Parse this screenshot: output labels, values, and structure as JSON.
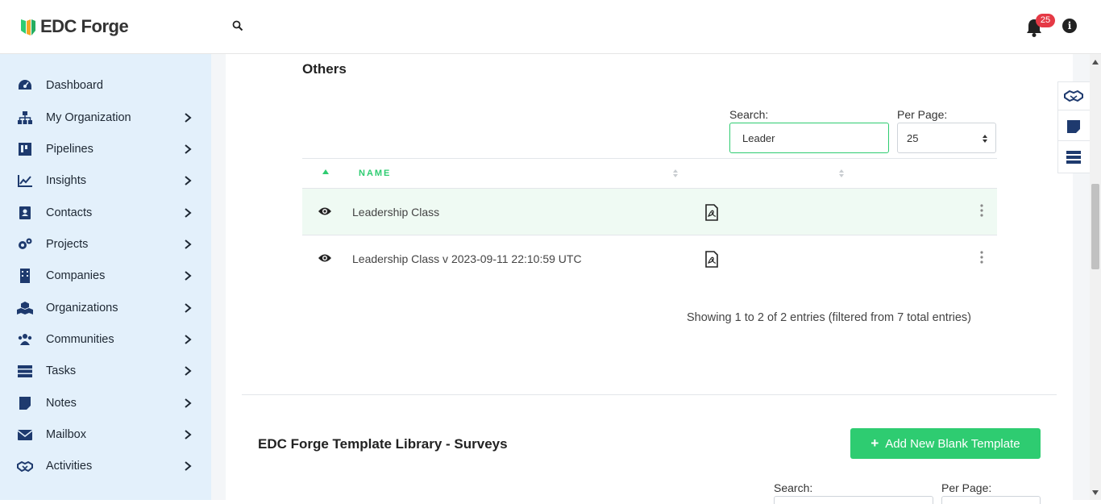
{
  "app": {
    "logo_text": "EDC Forge",
    "notifications_count": "25",
    "info_label": "i"
  },
  "colors": {
    "accent": "#2ecc71",
    "sidebar_bg": "#e3f0fb",
    "badge": "#e53945"
  },
  "sidebar": {
    "items": [
      {
        "label": "Dashboard",
        "icon": "dashboard-gauge-icon",
        "chevron": false
      },
      {
        "label": "My Organization",
        "icon": "org-chart-icon",
        "chevron": true
      },
      {
        "label": "Pipelines",
        "icon": "kanban-icon",
        "chevron": true
      },
      {
        "label": "Insights",
        "icon": "line-chart-icon",
        "chevron": true
      },
      {
        "label": "Contacts",
        "icon": "contact-card-icon",
        "chevron": true
      },
      {
        "label": "Projects",
        "icon": "gears-icon",
        "chevron": true
      },
      {
        "label": "Companies",
        "icon": "building-icon",
        "chevron": true
      },
      {
        "label": "Organizations",
        "icon": "cubes-icon",
        "chevron": true
      },
      {
        "label": "Communities",
        "icon": "users-icon",
        "chevron": true
      },
      {
        "label": "Tasks",
        "icon": "tasks-icon",
        "chevron": true
      },
      {
        "label": "Notes",
        "icon": "sticky-note-icon",
        "chevron": true
      },
      {
        "label": "Mailbox",
        "icon": "envelope-icon",
        "chevron": true
      },
      {
        "label": "Activities",
        "icon": "handshake-icon",
        "chevron": true
      }
    ]
  },
  "others": {
    "title": "Others",
    "search_label": "Search:",
    "search_value": "Leader",
    "per_page_label": "Per Page:",
    "per_page_value": "25",
    "columns": {
      "name": "NAME"
    },
    "rows": [
      {
        "name": "Leadership Class"
      },
      {
        "name": "Leadership Class v 2023-09-11 22:10:59 UTC"
      }
    ],
    "entries_text": "Showing 1 to 2 of 2 entries (filtered from 7 total entries)"
  },
  "library": {
    "title": "EDC Forge Template Library - Surveys",
    "add_button": "Add New Blank Template",
    "search_label": "Search:",
    "per_page_label": "Per Page:"
  },
  "floating_panel": {
    "icons": [
      "handshake-icon",
      "note-icon",
      "server-list-icon"
    ]
  }
}
